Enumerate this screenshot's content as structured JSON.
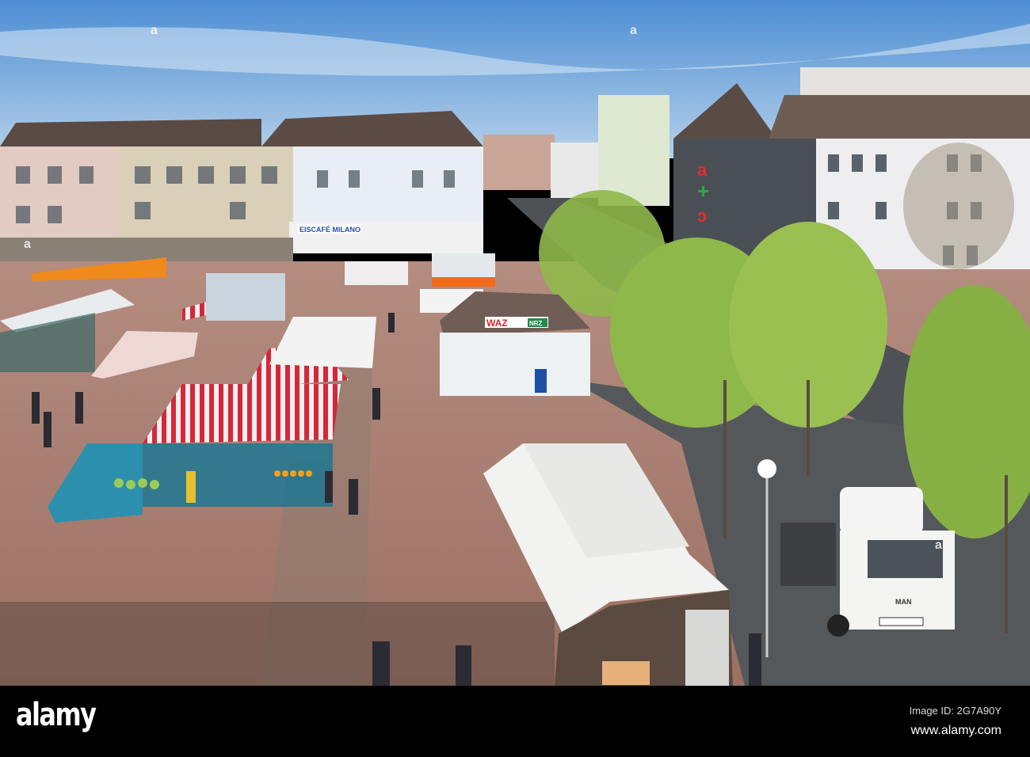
{
  "watermark": {
    "logo": "alamy",
    "image_id": "Image ID: 2G7A90Y",
    "url": "www.alamy.com"
  },
  "signs": {
    "cafe": "EISCAFÉ MILANO",
    "kiosk_left": "WAZ",
    "kiosk_right": "NRZ",
    "truck_brand": "MAN"
  },
  "colors": {
    "sky": "#5f9bd6",
    "plaza": "#a67c6e",
    "tree": "#8fb84a",
    "awning_red": "#d4283a"
  }
}
